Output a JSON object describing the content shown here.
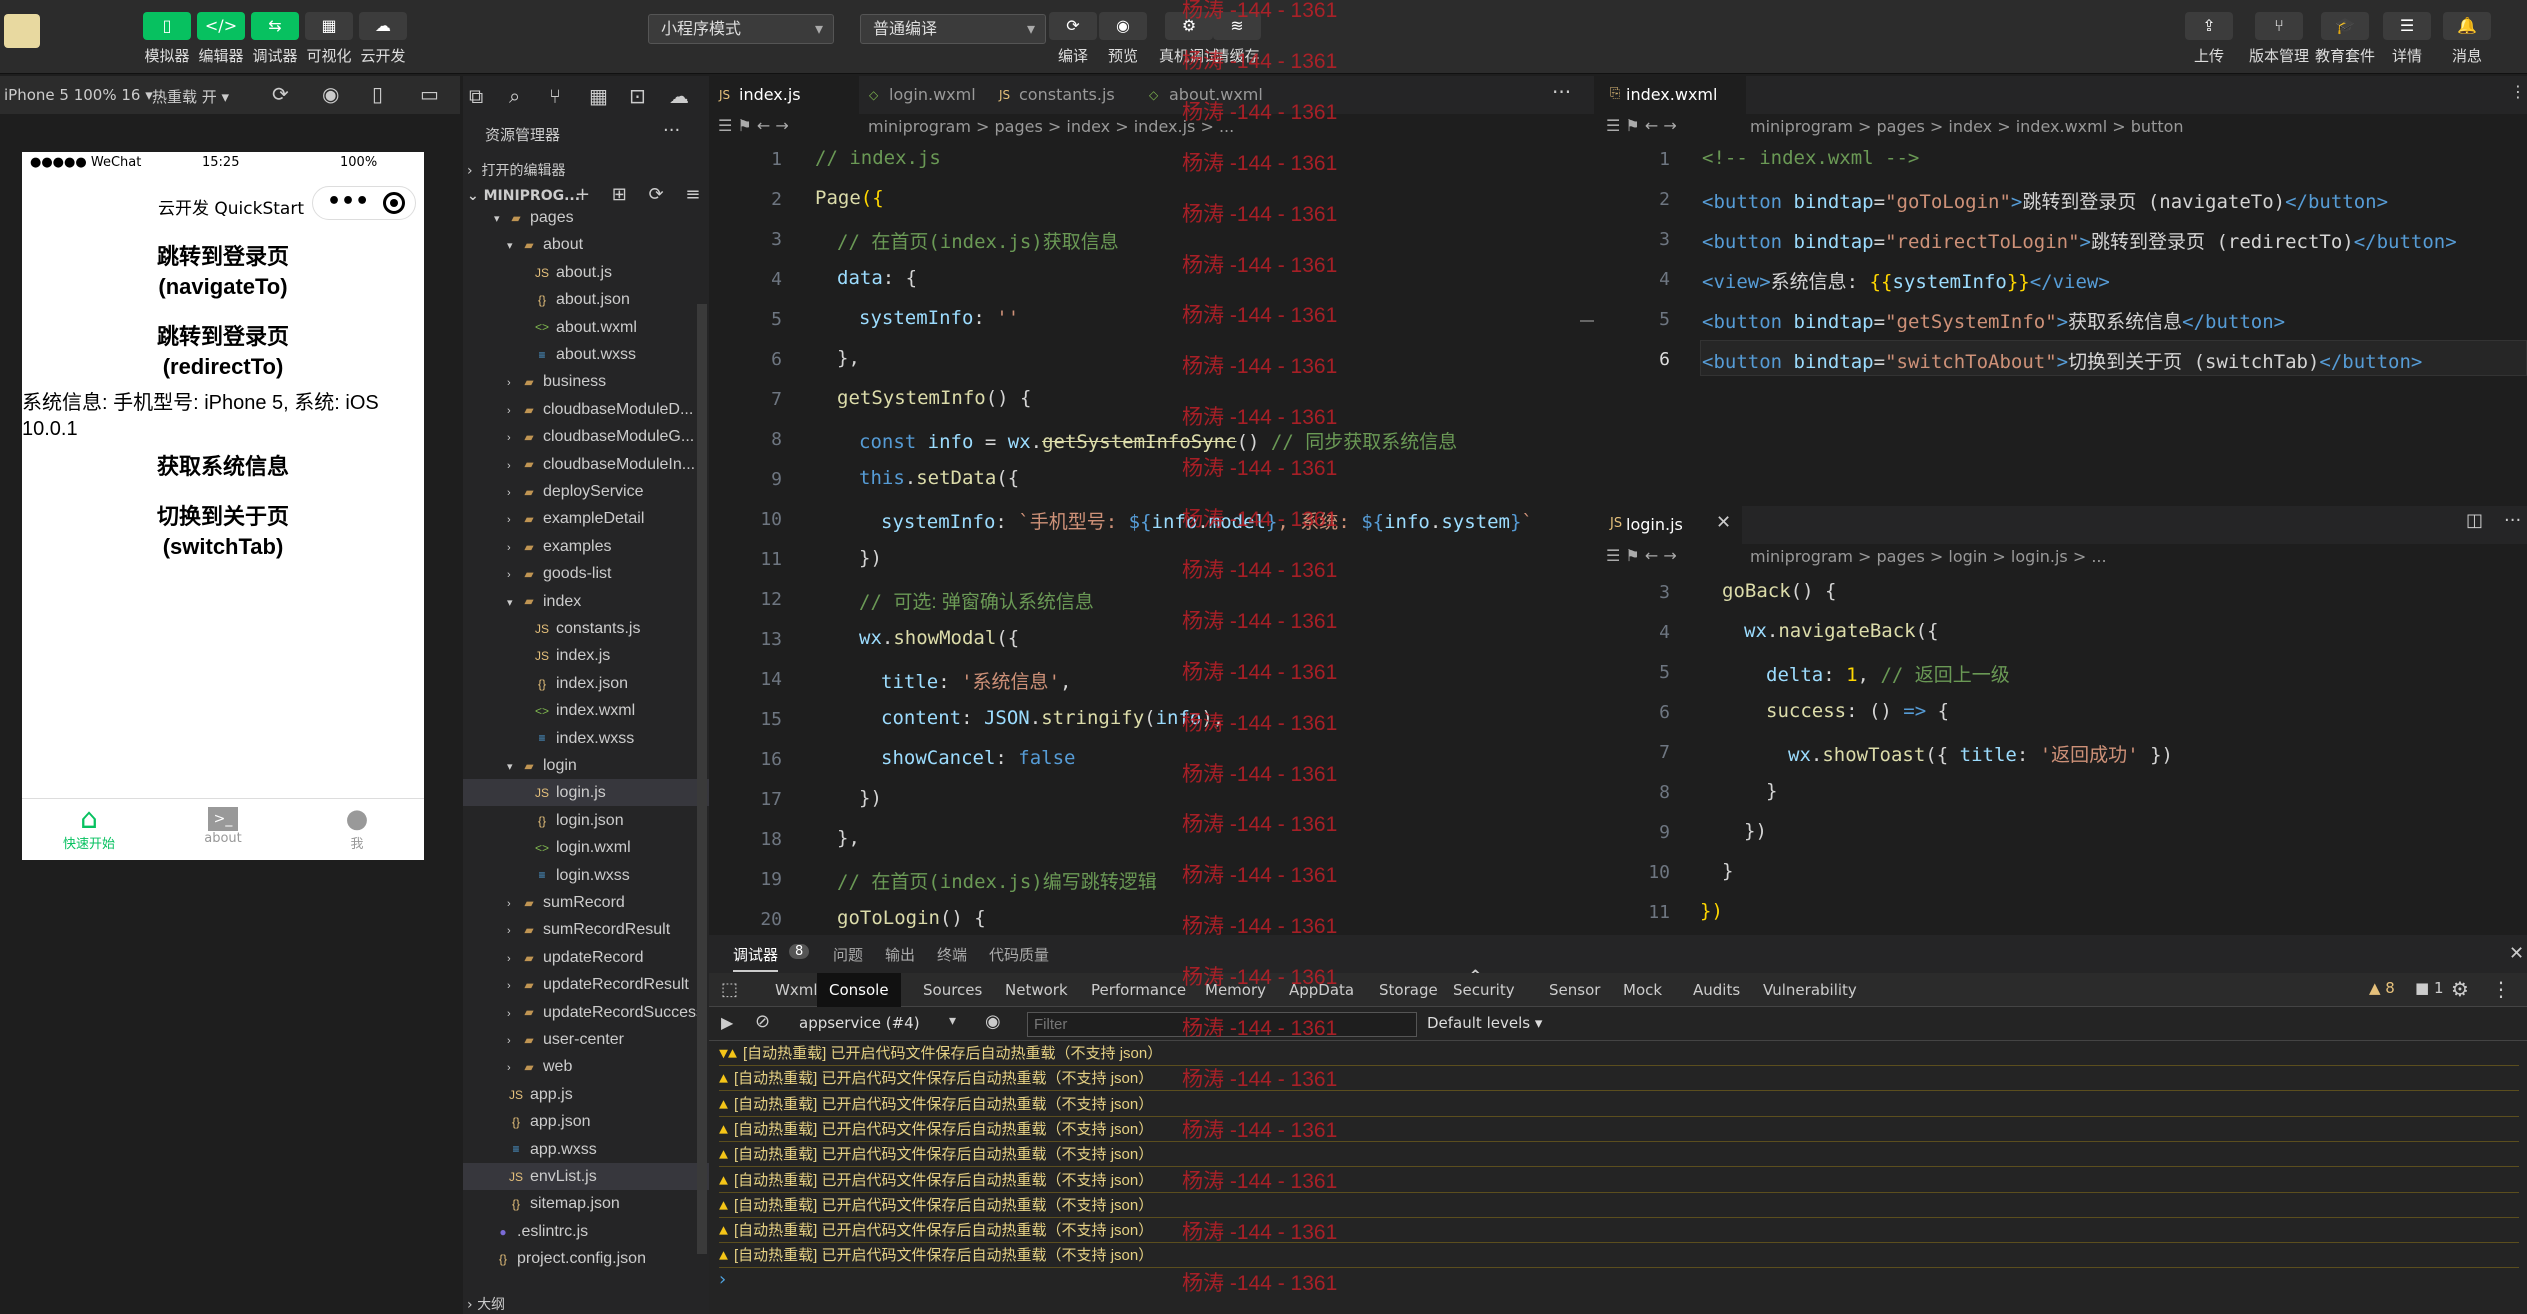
{
  "toolbar": {
    "left": [
      {
        "label": "模拟器",
        "icon": "phone-icon"
      },
      {
        "label": "编辑器",
        "icon": "code-icon"
      },
      {
        "label": "调试器",
        "icon": "debug-icon"
      },
      {
        "label": "可视化",
        "icon": "layout-icon"
      },
      {
        "label": "云开发",
        "icon": "cloud-icon"
      }
    ],
    "mode_select": "小程序模式",
    "compile_select": "普通编译",
    "center": [
      {
        "label": "编译",
        "icon": "refresh-icon"
      },
      {
        "label": "预览",
        "icon": "eye-icon"
      },
      {
        "label": "真机调试",
        "icon": "bug-icon"
      },
      {
        "label": "清缓存",
        "icon": "layers-icon"
      }
    ],
    "right": [
      {
        "label": "上传",
        "icon": "upload-icon"
      },
      {
        "label": "版本管理",
        "icon": "branch-icon"
      },
      {
        "label": "教育套件",
        "icon": "graduation-icon"
      },
      {
        "label": "详情",
        "icon": "menu-icon"
      },
      {
        "label": "消息",
        "icon": "bell-icon"
      }
    ]
  },
  "watermark": "杨涛 -144 - 1361",
  "simulator": {
    "device": "iPhone 5 100% 16 ▾",
    "hotreload": "热重载 开 ▾",
    "status": {
      "carrier": "●●●●● WeChat",
      "time": "15:25",
      "battery": "100%"
    },
    "nav_title": "云开发 QuickStart",
    "capsule_dots": "•••",
    "buttons": [
      "跳转到登录页\n(navigateTo)",
      "跳转到登录页\n(redirectTo)"
    ],
    "sysinfo": "系统信息: 手机型号: iPhone 5, 系统: iOS 10.0.1",
    "buttons2": [
      "获取系统信息",
      "切换到关于页\n(switchTab)"
    ],
    "tabbar": [
      {
        "label": "快速开始",
        "active": true
      },
      {
        "label": "about",
        "active": false
      },
      {
        "label": "我",
        "active": false
      }
    ]
  },
  "explorer": {
    "title": "资源管理器",
    "open_editors": "打开的编辑器",
    "project": "MINIPROG...",
    "items": [
      {
        "name": "pages",
        "depth": 1,
        "type": "folder",
        "open": true
      },
      {
        "name": "about",
        "depth": 2,
        "type": "folder",
        "open": true
      },
      {
        "name": "about.js",
        "depth": 3,
        "type": "js"
      },
      {
        "name": "about.json",
        "depth": 3,
        "type": "json"
      },
      {
        "name": "about.wxml",
        "depth": 3,
        "type": "wxml"
      },
      {
        "name": "about.wxss",
        "depth": 3,
        "type": "wxss"
      },
      {
        "name": "business",
        "depth": 2,
        "type": "folder"
      },
      {
        "name": "cloudbaseModuleD...",
        "depth": 2,
        "type": "folder"
      },
      {
        "name": "cloudbaseModuleG...",
        "depth": 2,
        "type": "folder"
      },
      {
        "name": "cloudbaseModuleIn...",
        "depth": 2,
        "type": "folder"
      },
      {
        "name": "deployService",
        "depth": 2,
        "type": "folder"
      },
      {
        "name": "exampleDetail",
        "depth": 2,
        "type": "folder"
      },
      {
        "name": "examples",
        "depth": 2,
        "type": "folder"
      },
      {
        "name": "goods-list",
        "depth": 2,
        "type": "folder"
      },
      {
        "name": "index",
        "depth": 2,
        "type": "folder",
        "open": true
      },
      {
        "name": "constants.js",
        "depth": 3,
        "type": "js"
      },
      {
        "name": "index.js",
        "depth": 3,
        "type": "js"
      },
      {
        "name": "index.json",
        "depth": 3,
        "type": "json"
      },
      {
        "name": "index.wxml",
        "depth": 3,
        "type": "wxml"
      },
      {
        "name": "index.wxss",
        "depth": 3,
        "type": "wxss"
      },
      {
        "name": "login",
        "depth": 2,
        "type": "folder",
        "open": true
      },
      {
        "name": "login.js",
        "depth": 3,
        "type": "js",
        "selected": true
      },
      {
        "name": "login.json",
        "depth": 3,
        "type": "json"
      },
      {
        "name": "login.wxml",
        "depth": 3,
        "type": "wxml"
      },
      {
        "name": "login.wxss",
        "depth": 3,
        "type": "wxss"
      },
      {
        "name": "sumRecord",
        "depth": 2,
        "type": "folder"
      },
      {
        "name": "sumRecordResult",
        "depth": 2,
        "type": "folder"
      },
      {
        "name": "updateRecord",
        "depth": 2,
        "type": "folder"
      },
      {
        "name": "updateRecordResult",
        "depth": 2,
        "type": "folder"
      },
      {
        "name": "updateRecordSuccess",
        "depth": 2,
        "type": "folder"
      },
      {
        "name": "user-center",
        "depth": 2,
        "type": "folder"
      },
      {
        "name": "web",
        "depth": 2,
        "type": "folder"
      },
      {
        "name": "app.js",
        "depth": 1,
        "type": "js"
      },
      {
        "name": "app.json",
        "depth": 1,
        "type": "json"
      },
      {
        "name": "app.wxss",
        "depth": 1,
        "type": "wxss"
      },
      {
        "name": "envList.js",
        "depth": 1,
        "type": "js",
        "selected": true
      },
      {
        "name": "sitemap.json",
        "depth": 1,
        "type": "json"
      },
      {
        "name": ".eslintrc.js",
        "depth": 0,
        "type": "eslint"
      },
      {
        "name": "project.config.json",
        "depth": 0,
        "type": "json"
      }
    ],
    "outline": "大纲"
  },
  "editor1": {
    "tabs": [
      "index.js",
      "login.wxml",
      "constants.js",
      "about.wxml"
    ],
    "breadcrumb": "miniprogram > pages > index > index.js > ...",
    "line_numbers": [
      "1",
      "2",
      "3",
      "4",
      "5",
      "6",
      "7",
      "8",
      "9",
      "10",
      "11",
      "12",
      "13",
      "14",
      "15",
      "16",
      "17",
      "18",
      "19",
      "20"
    ]
  },
  "editor2": {
    "tab": "index.wxml",
    "breadcrumb": "miniprogram > pages > index > index.wxml > button",
    "line_numbers": [
      "1",
      "2",
      "3",
      "4",
      "5",
      "6"
    ]
  },
  "editor3": {
    "tab": "login.js",
    "breadcrumb": "miniprogram > pages > login > login.js > ...",
    "line_numbers": [
      "3",
      "4",
      "5",
      "6",
      "7",
      "8",
      "9",
      "10",
      "11"
    ]
  },
  "console": {
    "panel_tabs": [
      "调试器",
      "问题",
      "输出",
      "终端",
      "代码质量"
    ],
    "badge": "8",
    "devtools_tabs": [
      "Wxml",
      "Console",
      "Sources",
      "Network",
      "Performance",
      "Memory",
      "AppData",
      "Storage",
      "Security",
      "Sensor",
      "Mock",
      "Audits",
      "Vulnerability"
    ],
    "context": "appservice (#4)",
    "filter_placeholder": "Filter",
    "levels": "Default levels ▾",
    "warn_count": "▲ 8",
    "info_count": "■ 1",
    "message": "[自动热重载] 已开启代码文件保存后自动热重载（不支持 json）",
    "rows": 9,
    "prompt": "›"
  }
}
